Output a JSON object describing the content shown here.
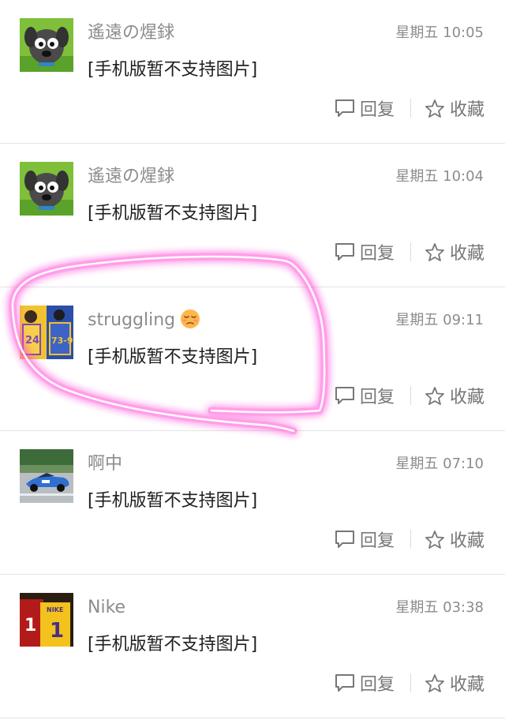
{
  "posts": [
    {
      "author": "遙遠の煋銶",
      "time": "星期五 10:05",
      "content": "[手机版暂不支持图片]",
      "avatar": "gray-dog-cartoon",
      "reply_label": "回复",
      "fav_label": "收藏"
    },
    {
      "author": "遙遠の煋銶",
      "time": "星期五 10:04",
      "content": "[手机版暂不支持图片]",
      "avatar": "gray-dog-cartoon",
      "reply_label": "回复",
      "fav_label": "收藏"
    },
    {
      "author": "struggling",
      "time": "星期五 09:11",
      "content": "[手机版暂不支持图片]",
      "avatar": "basketball-jerseys",
      "emoji": "pensive-face",
      "reply_label": "回复",
      "fav_label": "收藏"
    },
    {
      "author": "啊中",
      "time": "星期五 07:10",
      "content": "[手机版暂不支持图片]",
      "avatar": "blue-race-car",
      "reply_label": "回复",
      "fav_label": "收藏"
    },
    {
      "author": "Nike",
      "time": "星期五 03:38",
      "content": "[手机版暂不支持图片]",
      "avatar": "red-yellow-jerseys",
      "reply_label": "回复",
      "fav_label": "收藏"
    }
  ],
  "colors": {
    "meta_text": "#8c8c8c",
    "body_text": "#1e1e1e",
    "action_text": "#777777",
    "divider": "#e4e4e4",
    "highlight": "#ff4fd8"
  },
  "icons": {
    "reply": "speech-bubble-icon",
    "favorite": "star-outline-icon"
  }
}
